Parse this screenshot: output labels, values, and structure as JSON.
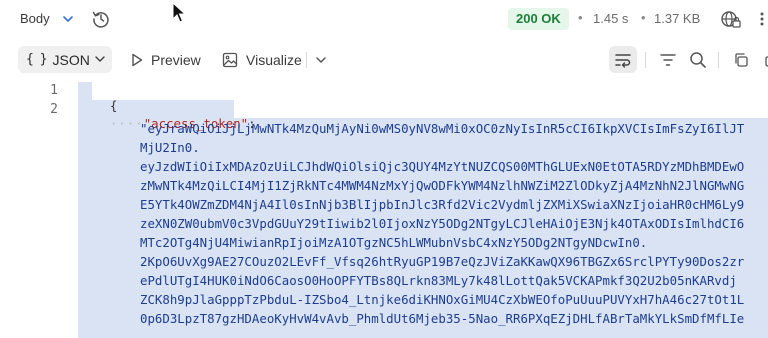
{
  "topbar": {
    "body_label": "Body",
    "status": "200 OK",
    "time": "1.45 s",
    "size": "1.37 KB",
    "separator": "•"
  },
  "toolbar": {
    "format": "JSON",
    "preview": "Preview",
    "visualize": "Visualize"
  },
  "editor": {
    "line_numbers": [
      "1",
      "2"
    ],
    "open_brace": "{",
    "indent": "····",
    "key": "\"access_token\"",
    "colon": ":",
    "value_lines": [
      "\"eyJraWQiOiJjLjMwNTk4MzQuMjAyNi0wMS0yNV8wMi0xOC0zNyIsInR5cCI6IkpXVCIsImFsZyI6IlJT",
      "MjU2In0.",
      "eyJzdWIiOiIxMDAzOzUiLCJhdWQiOlsiQjc3QUY4MzYtNUZCQS00MThGLUExN0EtOTA5RDYzMDhBMDEwO",
      "zMwNTk4MzQiLCI4MjI1ZjRkNTc4MWM4NzMxYjQwODFkYWM4NzlhNWZiM2ZlODkyZjA4MzNhN2JlNGMwNG",
      "E5YTk4OWZmZDM4NjA4Il0sInNjb3BlIjpbInJlc3Rfd2Vic2VydmljZXMiXSwiaXNzIjoiaHR0cHM6Ly9",
      "zeXN0ZW0ubmV0c3VpdGUuY29tIiwib2l0IjoxNzY5ODg2NTgyLCJleHAiOjE3Njk4OTAxODIsImlhdCI6",
      "MTc2OTg4NjU4MiwianRpIjoiMzA1OTgzNC5hLWMubnVsbC4xNzY5ODg2NTgyNDcwIn0.",
      "2KpO6UvXg9AE27COuzO2LEvFf_Vfsq26htRyuGP19B7eQzJViZaKKawQX96TBGZx6SrclPYTy90Dos2zr",
      "ePdlUTgI4HUK0iNdO6CaosO0HoOPFYTBs8QLrkn83MLy7k48lLottQak5VCKAPmkf3Q2U2b05nKARvdj",
      "ZCK8h9pJlaGpppTzPbduL-IZSbo4_Ltnjke6diKHNOxGiMU4CzXbWEOfoPuUuuPUVYxH7hA46c27tOt1L",
      "0p6D3LpzT87gzHDAeoKyHvW4vAvb_PhmldUt6Mjeb35-5Nao_RR6PXqEZjDHLfABrTaMkYLkSmDfMfLIe"
    ]
  },
  "colors": {
    "status_bg": "#e5f6ea",
    "status_text": "#1a7f37",
    "selection": "#d9e3f4",
    "key": "#b3261e",
    "string": "#1d3d8f"
  },
  "icons": [
    "chevron-down-icon",
    "history-icon",
    "cursor-icon",
    "globe-lock-icon",
    "more-icon",
    "play-icon",
    "image-icon",
    "wrap-icon",
    "filter-icon",
    "search-icon",
    "copy-icon"
  ]
}
